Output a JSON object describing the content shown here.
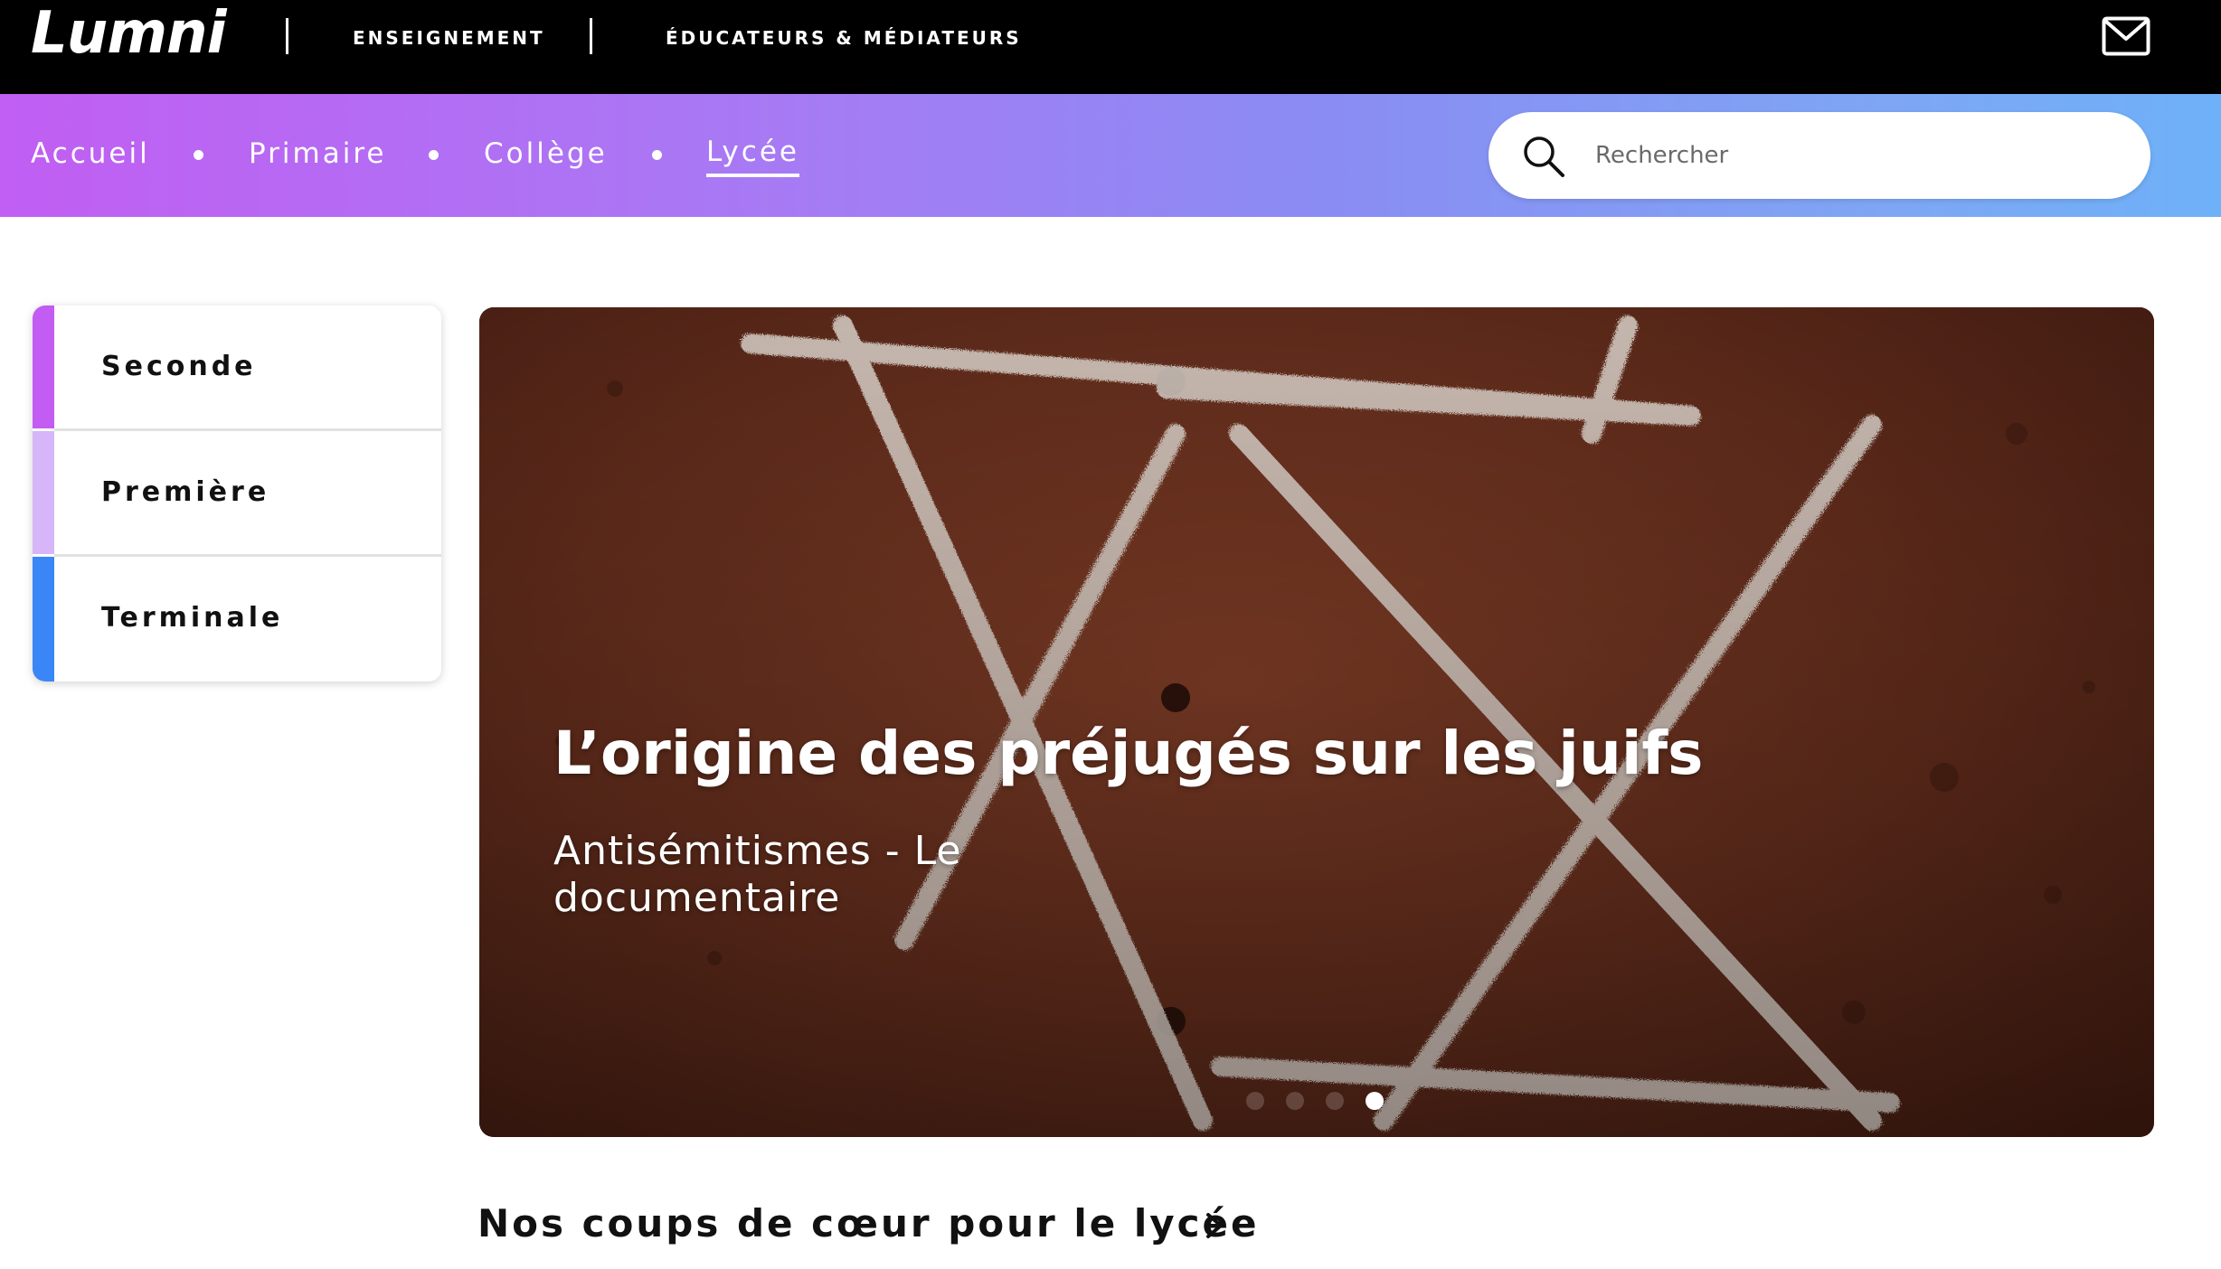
{
  "header": {
    "logo_text": "Lumni",
    "links": [
      "ENSEIGNEMENT",
      "ÉDUCATEURS & MÉDIATEURS"
    ],
    "mail_icon": "mail-icon"
  },
  "nav": {
    "items": [
      {
        "label": "Accueil",
        "active": false
      },
      {
        "label": "Primaire",
        "active": false
      },
      {
        "label": "Collège",
        "active": false
      },
      {
        "label": "Lycée",
        "active": true
      }
    ],
    "search": {
      "placeholder": "Rechercher",
      "value": "",
      "icon": "search-icon"
    },
    "gradient_colors": [
      "#c15ef3",
      "#6eb1f8"
    ]
  },
  "sidebar": {
    "items": [
      {
        "label": "Seconde",
        "color": "#c25cf2"
      },
      {
        "label": "Première",
        "color": "#d6b6f8"
      },
      {
        "label": "Terminale",
        "color": "#3a86f7"
      }
    ]
  },
  "hero": {
    "title": "L’origine des préjugés sur les juifs",
    "subtitle": "Antisémitismes - Le documentaire",
    "slides_total": 4,
    "active_slide": 4
  },
  "section": {
    "title": "Nos coups de cœur pour le lycée",
    "chevron_icon": "chevron-right-icon"
  }
}
